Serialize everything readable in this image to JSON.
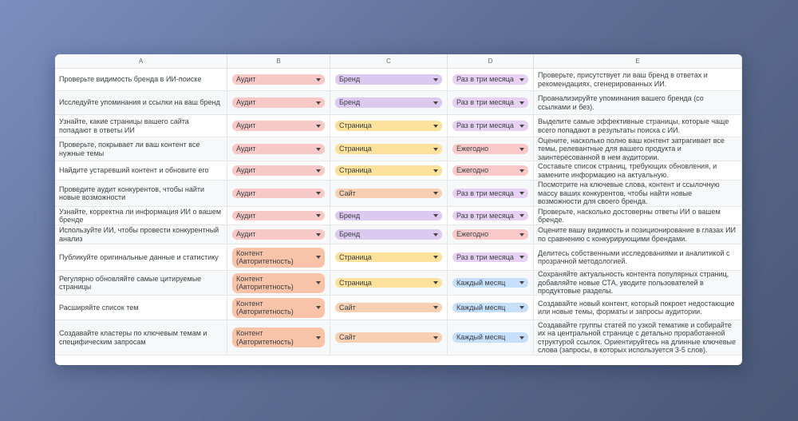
{
  "columns": [
    "A",
    "B",
    "C",
    "D",
    "E"
  ],
  "colors": {
    "audit": "#f7c9c6",
    "content": "#f8c3a8",
    "brand": "#dcc9ef",
    "page": "#fbe19a",
    "site": "#f7d0b4",
    "quarter": "#e6d1f2",
    "yearly": "#f8c9c6",
    "monthly": "#c6dffb"
  },
  "rows": [
    {
      "a": "Проверьте видимость бренда в ИИ-поиске",
      "b": "Аудит",
      "bc": "audit",
      "c": "Бренд",
      "cc": "brand",
      "d": "Раз в три месяца",
      "dc": "quarter",
      "e": "Проверьте, присутствует ли ваш бренд в ответах и рекомендациях, сгенерированных ИИ."
    },
    {
      "a": "Исследуйте упоминания и ссылки на ваш бренд",
      "b": "Аудит",
      "bc": "audit",
      "c": "Бренд",
      "cc": "brand",
      "d": "Раз в три месяца",
      "dc": "quarter",
      "e": "Проанализируйте упоминания вашего бренда (со ссылками и без)."
    },
    {
      "a": "Узнайте, какие страницы вашего сайта попадают в ответы ИИ",
      "b": "Аудит",
      "bc": "audit",
      "c": "Страница",
      "cc": "page",
      "d": "Раз в три месяца",
      "dc": "quarter",
      "e": "Выделите самые эффективные страницы, которые чаще всего попадают в результаты поиска с ИИ."
    },
    {
      "a": "Проверьте, покрывает ли ваш контент все нужные темы",
      "b": "Аудит",
      "bc": "audit",
      "c": "Страница",
      "cc": "page",
      "d": "Ежегодно",
      "dc": "yearly",
      "e": "Оцените, насколько полно ваш контент затрагивает все темы, релевантные для вашего продукта и заинтересованной в нем аудитории."
    },
    {
      "a": "Найдите устаревший контент и обновите его",
      "b": "Аудит",
      "bc": "audit",
      "c": "Страница",
      "cc": "page",
      "d": "Ежегодно",
      "dc": "yearly",
      "e": "Составьте список страниц, требующих обновления, и замените информацию на актуальную."
    },
    {
      "a": "Проведите аудит конкурентов, чтобы найти новые возможности",
      "b": "Аудит",
      "bc": "audit",
      "c": "Сайт",
      "cc": "site",
      "d": "Раз в три месяца",
      "dc": "quarter",
      "e": "Посмотрите на ключевые слова, контент и ссылочную массу ваших конкурентов, чтобы найти новые возможности для своего бренда."
    },
    {
      "a": "Узнайте, корректна ли информация ИИ о вашем бренде",
      "b": "Аудит",
      "bc": "audit",
      "c": "Бренд",
      "cc": "brand",
      "d": "Раз в три месяца",
      "dc": "quarter",
      "e": "Проверьте, насколько достоверны ответы ИИ о вашем бренде."
    },
    {
      "a": "Используйте ИИ, чтобы провести конкурентный анализ",
      "b": "Аудит",
      "bc": "audit",
      "c": "Бренд",
      "cc": "brand",
      "d": "Ежегодно",
      "dc": "yearly",
      "e": "Оцените вашу видимость и позиционирование в глазах ИИ по сравнению с конкурирующими брендами."
    },
    {
      "a": "Публикуйте оригинальные данные и статистику",
      "b": "Контент (Авторитетность)",
      "bc": "content",
      "c": "Страница",
      "cc": "page",
      "d": "Раз в три месяца",
      "dc": "quarter",
      "e": "Делитесь собственными исследованиями и аналитикой с прозрачной методологией."
    },
    {
      "a": "Регулярно обновляйте самые цитируемые страницы",
      "b": "Контент (Авторитетность)",
      "bc": "content",
      "c": "Страница",
      "cc": "page",
      "d": "Каждый месяц",
      "dc": "monthly",
      "e": "Сохраняйте актуальность контента популярных страниц, добавляйте новые СТА, уводите пользователей в продуктовые разделы."
    },
    {
      "a": "Расширяйте список тем",
      "b": "Контент (Авторитетность)",
      "bc": "content",
      "c": "Сайт",
      "cc": "site",
      "d": "Каждый месяц",
      "dc": "monthly",
      "e": "Создавайте новый контент, который покроет недостающие или новые темы, форматы и запросы аудитории."
    },
    {
      "a": "Создавайте кластеры по ключевым темам и специфическим запросам",
      "b": "Контент (Авторитетность)",
      "bc": "content",
      "c": "Сайт",
      "cc": "site",
      "d": "Каждый месяц",
      "dc": "monthly",
      "e": "Создавайте группы статей по узкой тематике и собирайте их на центральной странице с детально проработанной структурой ссылок. Ориентируйтесь на длинные ключевые слова (запросы, в которых используется 3-5 слов)."
    }
  ]
}
